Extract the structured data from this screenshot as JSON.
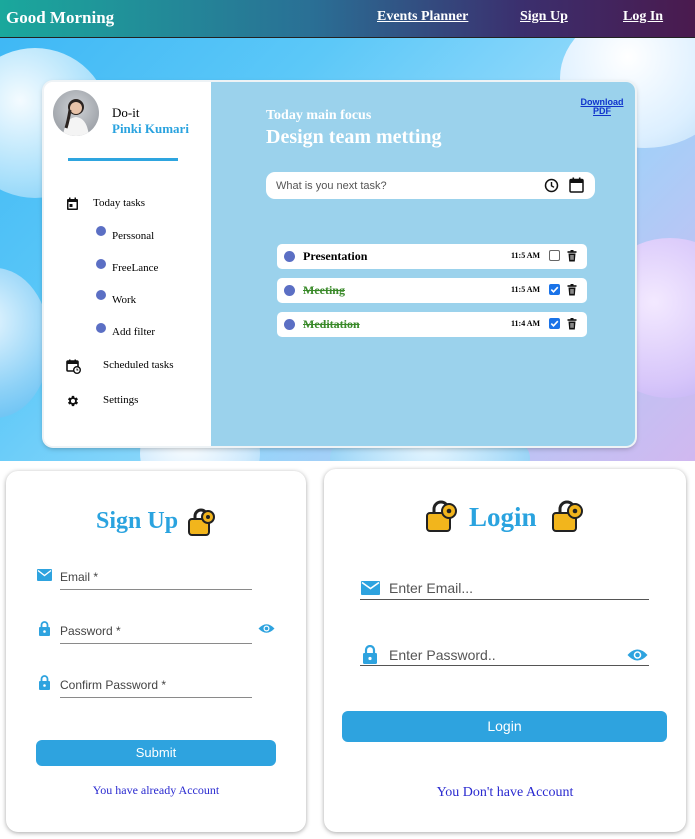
{
  "nav": {
    "brand": "Good Morning",
    "links": [
      "Events Planner",
      "Sign Up",
      "Log In"
    ]
  },
  "sidebar": {
    "app_name": "Do-it",
    "user_name": "Pinki Kumari",
    "items": [
      {
        "label": "Today tasks",
        "icon": "calendar-icon"
      },
      {
        "label": "Perssonal",
        "icon": "dot"
      },
      {
        "label": "FreeLance",
        "icon": "dot"
      },
      {
        "label": "Work",
        "icon": "dot"
      },
      {
        "label": "Add filter",
        "icon": "dot"
      },
      {
        "label": "Scheduled tasks",
        "icon": "calendar-clock-icon"
      },
      {
        "label": "Settings",
        "icon": "gear-icon"
      }
    ]
  },
  "main": {
    "focus_label": "Today main focus",
    "focus_title": "Design team metting",
    "download_label": "Download PDF",
    "task_input_placeholder": "What is you next task?",
    "tasks": [
      {
        "name": "Presentation",
        "time": "11:5 AM",
        "done": false
      },
      {
        "name": "Meeting",
        "time": "11:5 AM",
        "done": true
      },
      {
        "name": "Meditation",
        "time": "11:4 AM",
        "done": true
      }
    ]
  },
  "signup": {
    "title": "Sign Up",
    "email_label": "Email *",
    "password_label": "Password *",
    "confirm_label": "Confirm Password *",
    "submit_label": "Submit",
    "link_text": "You have already Account"
  },
  "login": {
    "title": "Login",
    "email_placeholder": "Enter Email...",
    "password_placeholder": "Enter Password..",
    "button_label": "Login",
    "link_text": "You Don't have Account"
  },
  "colors": {
    "accent": "#2ea3df",
    "task_dot": "#5b6fc4",
    "done_text": "#3a8a2a",
    "main_panel": "#9bd2ec"
  }
}
